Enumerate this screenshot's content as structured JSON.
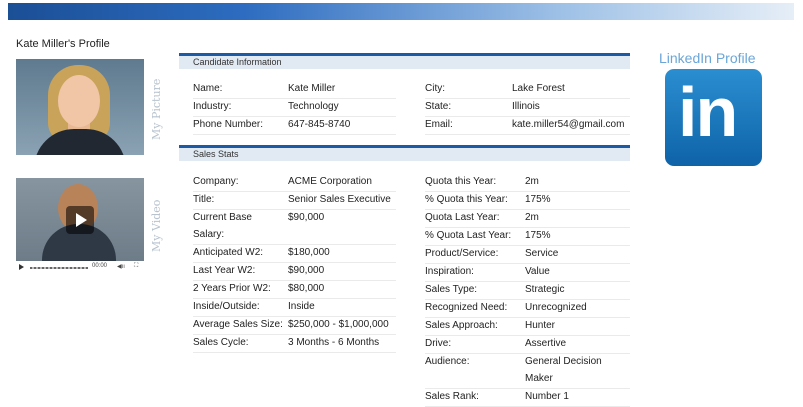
{
  "profile": {
    "title": "Kate Miller's Profile",
    "picture_label": "My Picture",
    "video_label": "My Video",
    "video_time": "00:00"
  },
  "candidate": {
    "header": "Candidate Information",
    "left": [
      {
        "label": "Name:",
        "value": "Kate Miller"
      },
      {
        "label": "Industry:",
        "value": "Technology"
      },
      {
        "label": "Phone Number:",
        "value": "647-845-8740"
      }
    ],
    "right": [
      {
        "label": "City:",
        "value": "Lake Forest"
      },
      {
        "label": "State:",
        "value": "Illinois"
      },
      {
        "label": "Email:",
        "value": "kate.miller54@gmail.com"
      }
    ]
  },
  "sales": {
    "header": "Sales Stats",
    "left": [
      {
        "label": "Company:",
        "value": "ACME Corporation"
      },
      {
        "label": "Title:",
        "value": "Senior Sales Executive"
      },
      {
        "label": "Current Base Salary:",
        "value": "$90,000"
      },
      {
        "label": "Anticipated W2:",
        "value": "$180,000"
      },
      {
        "label": "Last Year W2:",
        "value": "$90,000"
      },
      {
        "label": "2 Years Prior W2:",
        "value": "$80,000"
      },
      {
        "label": "Inside/Outside:",
        "value": "Inside"
      },
      {
        "label": "Average Sales Size:",
        "value": "$250,000 - $1,000,000"
      },
      {
        "label": "Sales Cycle:",
        "value": "3 Months - 6 Months"
      }
    ],
    "right": [
      {
        "label": "Quota this Year:",
        "value": "2m"
      },
      {
        "label": "% Quota this Year:",
        "value": "175%"
      },
      {
        "label": "Quota Last Year:",
        "value": "2m"
      },
      {
        "label": "% Quota Last Year:",
        "value": "175%"
      },
      {
        "label": "Product/Service:",
        "value": "Service"
      },
      {
        "label": "Inspiration:",
        "value": "Value"
      },
      {
        "label": "Sales Type:",
        "value": "Strategic"
      },
      {
        "label": "Recognized Need:",
        "value": "Unrecognized"
      },
      {
        "label": "Sales Approach:",
        "value": "Hunter"
      },
      {
        "label": "Drive:",
        "value": "Assertive"
      },
      {
        "label": "Audience:",
        "value": "General Decision Maker"
      },
      {
        "label": "Sales Rank:",
        "value": "Number 1"
      }
    ]
  },
  "linkedin": {
    "title": "LinkedIn Profile",
    "logo_text": "in",
    "icon": "linkedin-icon"
  },
  "colors": {
    "accent": "#1c5aa6",
    "header_bg": "#e1e9f2",
    "linkedin_blue": "#0f63a8"
  }
}
